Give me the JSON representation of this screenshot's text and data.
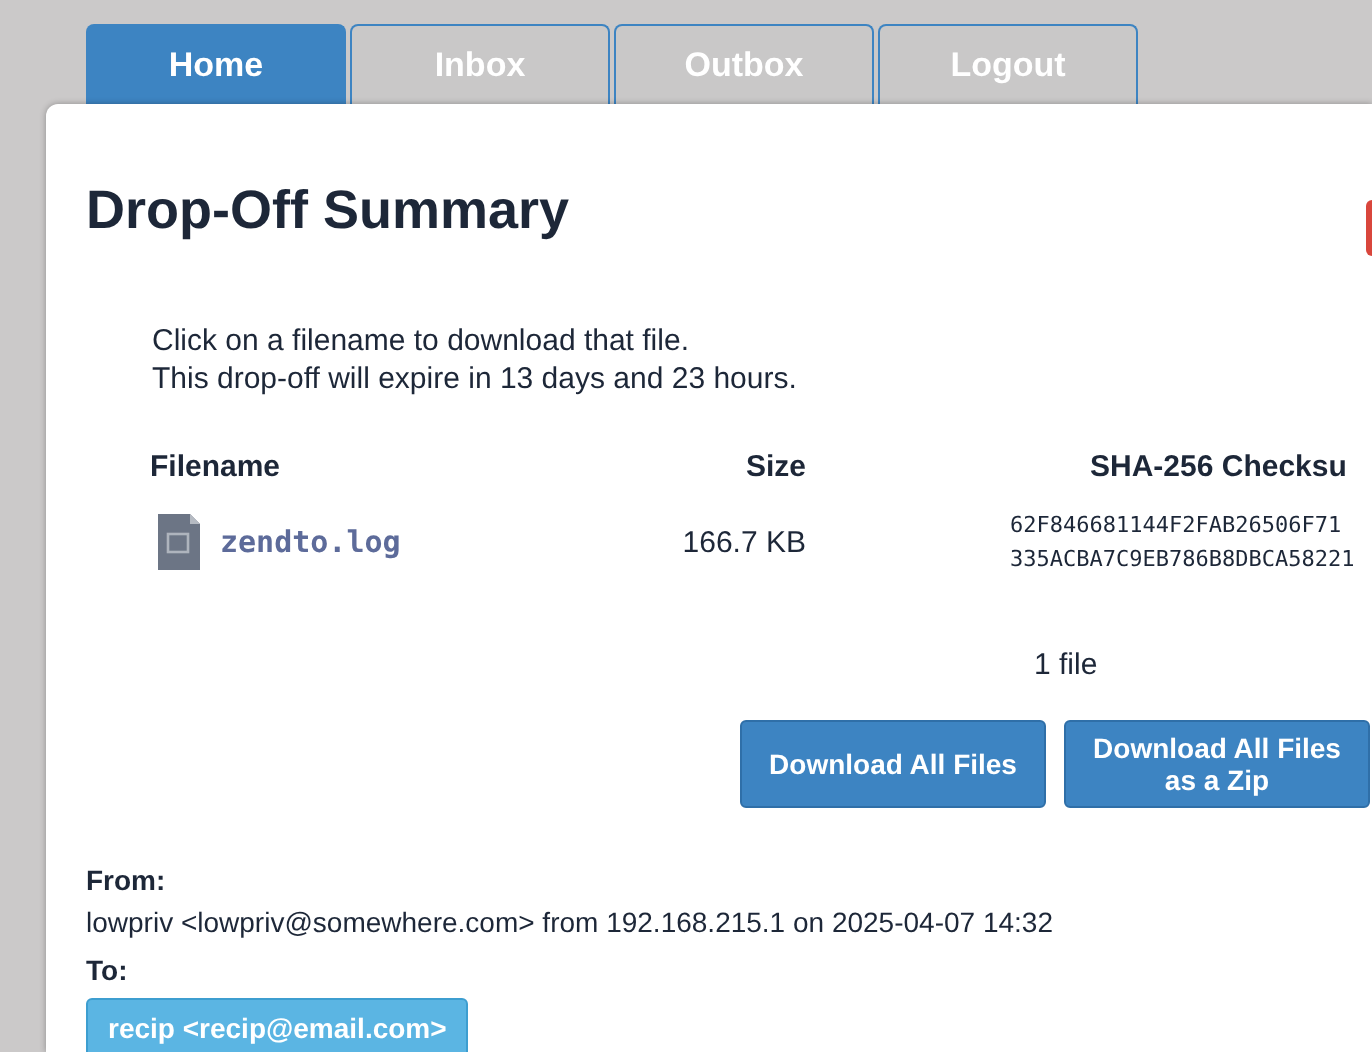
{
  "tabs": [
    {
      "label": "Home",
      "selected": true
    },
    {
      "label": "Inbox",
      "selected": false
    },
    {
      "label": "Outbox",
      "selected": false
    },
    {
      "label": "Logout",
      "selected": false
    }
  ],
  "title": "Drop-Off Summary",
  "intro": [
    "Click on a filename to download that file.",
    "This drop-off will expire in 13 days and 23 hours."
  ],
  "table": {
    "columns": [
      "Filename",
      "Size",
      "SHA-256 Checksu"
    ],
    "rows": [
      {
        "filename": "zendto.log",
        "size": "166.7 KB",
        "checksum": [
          "62F846681144F2FAB26506F71",
          "335ACBA7C9EB786B8DBCA58221"
        ]
      }
    ]
  },
  "file_count": "1 file",
  "buttons": [
    "Download All Files",
    "Download All Files as a Zip"
  ],
  "from": {
    "label": "From:",
    "value": "lowpriv <lowpriv@somewhere.com> from 192.168.215.1 on 2025-04-07 14:32"
  },
  "to": {
    "label": "To:",
    "recipients": [
      "recip <recip@email.com>"
    ]
  }
}
